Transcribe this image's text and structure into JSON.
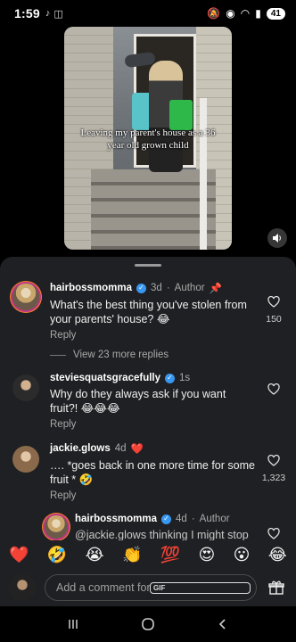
{
  "status_bar": {
    "time": "1:59",
    "battery": "41"
  },
  "video": {
    "caption": "Leaving my parent's house as a 36 year old grown child"
  },
  "comments": [
    {
      "username": "hairbossmomma",
      "time": "3d",
      "tag": "Author",
      "text": "What's the best thing you've stolen from your parents' house? 😂",
      "reply_label": "Reply",
      "likes": "150"
    },
    {
      "view_replies": "View 23 more replies"
    },
    {
      "username": "steviesquatsgracefully",
      "time": "1s",
      "text": "Why do they always ask if you want fruit?! 😂😂😂",
      "reply_label": "Reply",
      "likes": ""
    },
    {
      "username": "jackie.glows",
      "time": "4d",
      "text": "…. *goes back in one more time for some fruit * 🤣",
      "reply_label": "Reply",
      "likes": "1,323"
    },
    {
      "username": "hairbossmomma",
      "time": "4d",
      "tag": "Author",
      "text": "@jackie.glows thinking I might stop"
    }
  ],
  "emojis": [
    "❤️",
    "🤣",
    "😭",
    "👏",
    "💯",
    "😍",
    "😮",
    "😂"
  ],
  "composer": {
    "placeholder": "Add a comment for hairbossm…",
    "gif_label": "GIF"
  }
}
